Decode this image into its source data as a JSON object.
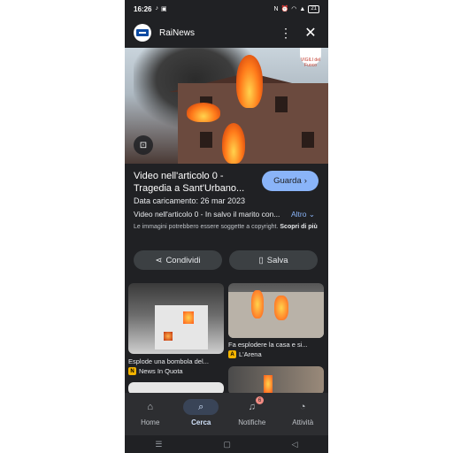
{
  "status_bar": {
    "time": "16:26",
    "left_icons": [
      "tiktok-icon",
      "gallery-icon"
    ],
    "right_icons": [
      "nfc-icon",
      "alarm-icon",
      "mute-icon",
      "wifi-icon",
      "signal-icon"
    ],
    "battery": "21"
  },
  "header": {
    "app_name": "RaiNews",
    "more_icon": "⋮",
    "close_icon": "✕"
  },
  "hero": {
    "watermark_text": "VIGILI del Fuoco"
  },
  "video": {
    "title": "Video nell'articolo 0 - Tragedia a Sant'Urbano...",
    "watch_label": "Guarda",
    "upload_date": "Data caricamento: 26 mar 2023",
    "description": "Video nell'articolo 0 - In salvo il marito con...",
    "more_label": "Altro",
    "copyright_text": "Le immagini potrebbero essere soggette a copyright.",
    "learn_more": "Scopri di più"
  },
  "actions": {
    "share_label": "Condividi",
    "save_label": "Salva"
  },
  "related": [
    {
      "caption": "Esplode una bombola del...",
      "source": "News In Quota",
      "source_initial": "N"
    },
    {
      "caption": "Fa esplodere la casa e si...",
      "source": "L'Arena",
      "source_initial": "A"
    }
  ],
  "nav": {
    "items": [
      {
        "label": "Home",
        "icon": "home-icon"
      },
      {
        "label": "Cerca",
        "icon": "search-icon"
      },
      {
        "label": "Notifiche",
        "icon": "bell-icon",
        "badge": "6"
      },
      {
        "label": "Attività",
        "icon": "activity-icon"
      }
    ],
    "active": "Cerca"
  },
  "colors": {
    "background": "#202124",
    "accent": "#8ab4f8",
    "nav_bg": "#2d2e31"
  }
}
